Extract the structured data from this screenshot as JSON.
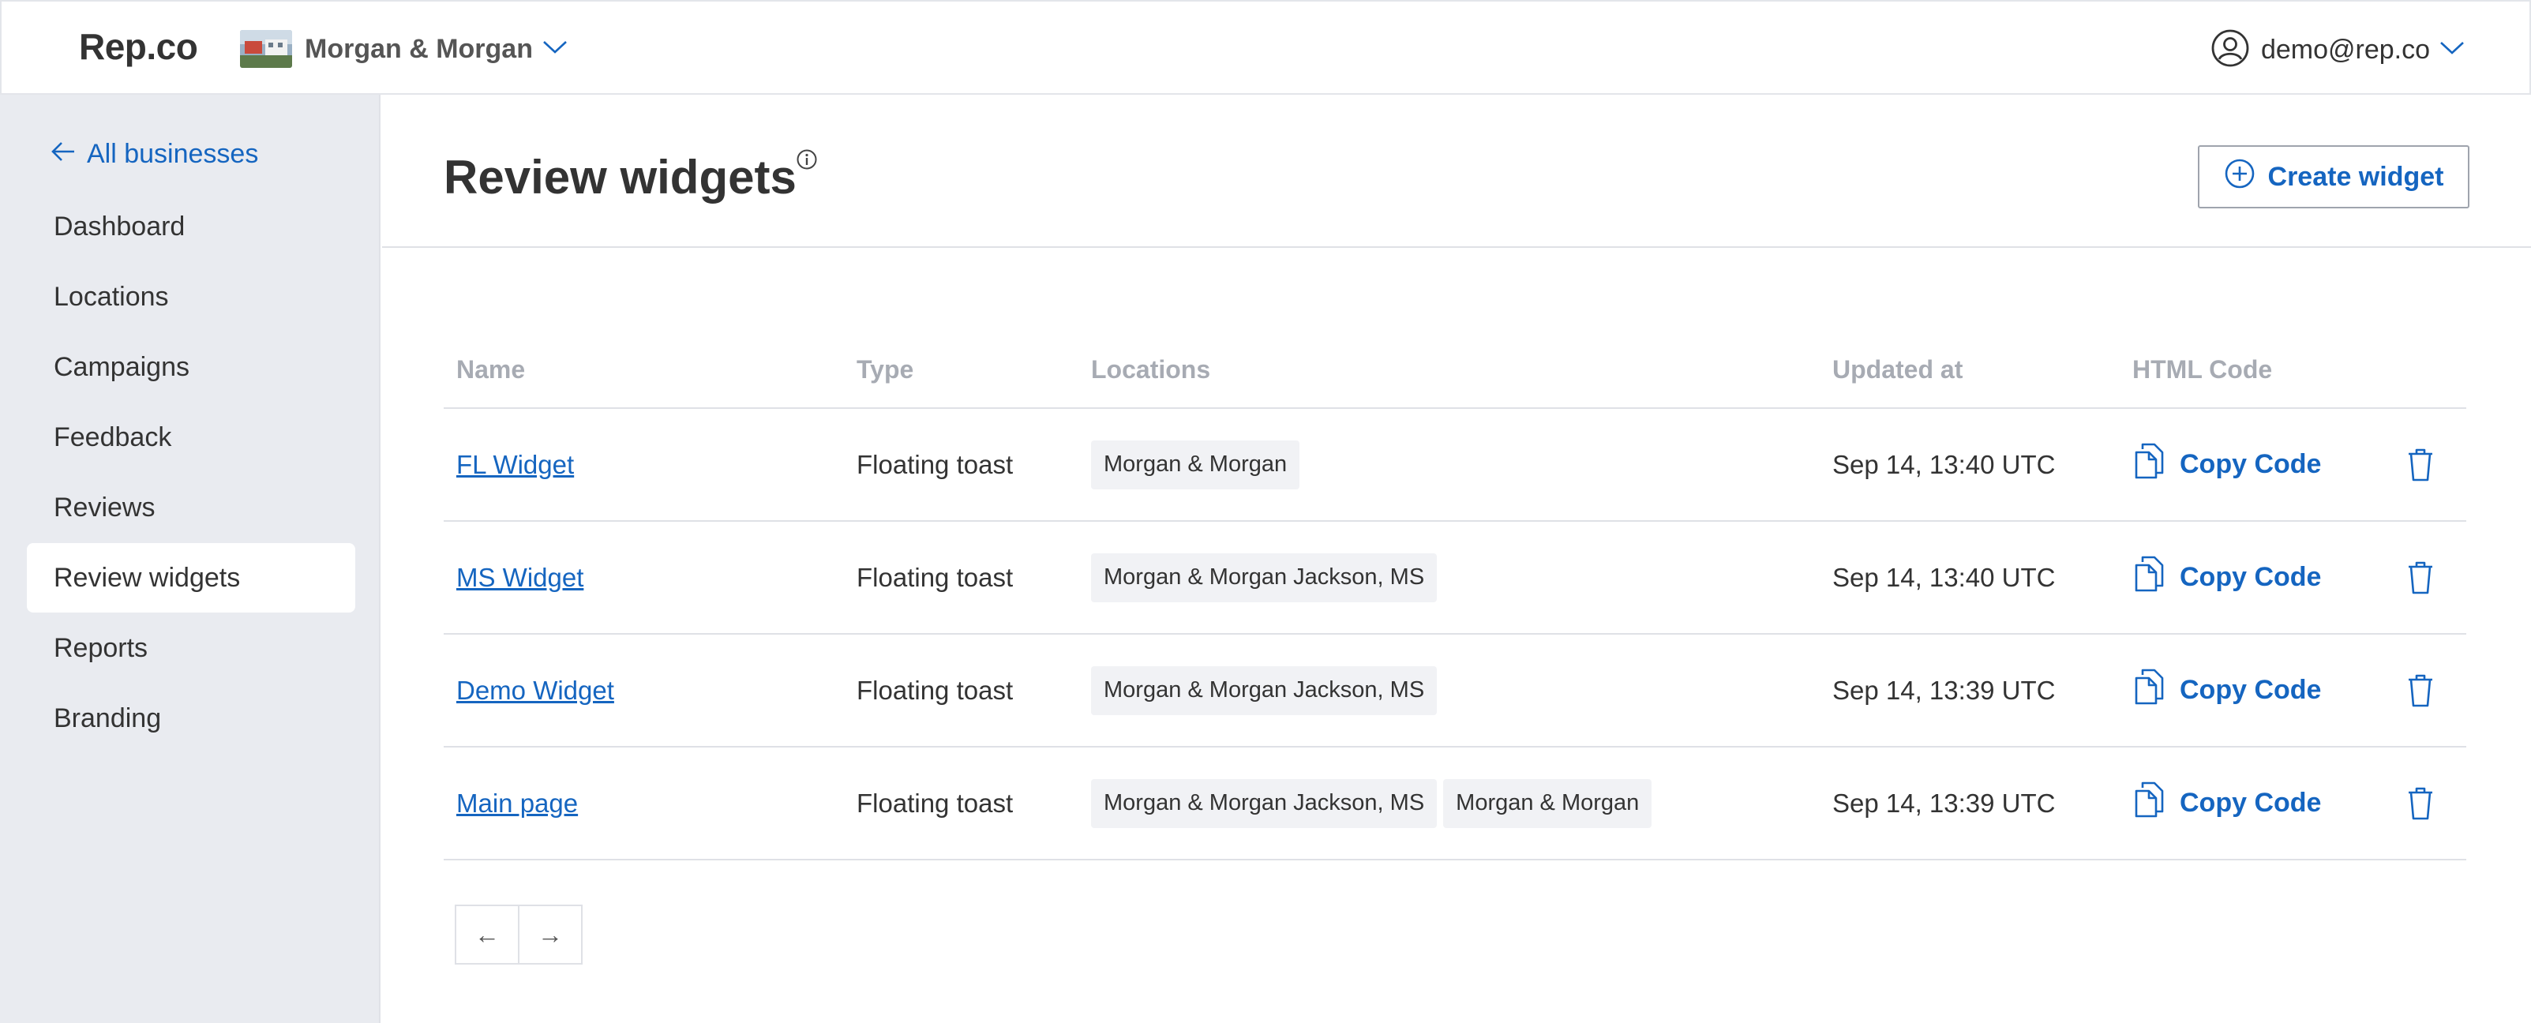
{
  "app": {
    "logo": "Rep.co"
  },
  "business_switcher": {
    "name": "Morgan & Morgan"
  },
  "user_menu": {
    "email": "demo@rep.co"
  },
  "sidebar": {
    "back_label": "All businesses",
    "items": [
      {
        "label": "Dashboard",
        "active": false
      },
      {
        "label": "Locations",
        "active": false
      },
      {
        "label": "Campaigns",
        "active": false
      },
      {
        "label": "Feedback",
        "active": false
      },
      {
        "label": "Reviews",
        "active": false
      },
      {
        "label": "Review widgets",
        "active": true
      },
      {
        "label": "Reports",
        "active": false
      },
      {
        "label": "Branding",
        "active": false
      }
    ]
  },
  "page": {
    "title": "Review widgets",
    "create_button": "Create widget"
  },
  "table": {
    "columns": [
      "Name",
      "Type",
      "Locations",
      "Updated at",
      "HTML Code"
    ],
    "rows": [
      {
        "name": "FL Widget",
        "type": "Floating toast",
        "locations": [
          "Morgan & Morgan"
        ],
        "updated": "Sep 14, 13:40 UTC",
        "action": "Copy Code"
      },
      {
        "name": "MS Widget",
        "type": "Floating toast",
        "locations": [
          "Morgan & Morgan Jackson, MS"
        ],
        "updated": "Sep 14, 13:40 UTC",
        "action": "Copy Code"
      },
      {
        "name": "Demo Widget",
        "type": "Floating toast",
        "locations": [
          "Morgan & Morgan Jackson, MS"
        ],
        "updated": "Sep 14, 13:39 UTC",
        "action": "Copy Code"
      },
      {
        "name": "Main page",
        "type": "Floating toast",
        "locations": [
          "Morgan & Morgan Jackson, MS",
          "Morgan & Morgan"
        ],
        "updated": "Sep 14, 13:39 UTC",
        "action": "Copy Code"
      }
    ]
  },
  "pagination": {
    "prev": "←",
    "next": "→"
  },
  "colors": {
    "accent": "#1565c0",
    "sidebar_bg": "#e9ebf0",
    "header_text": "#a7abb3"
  }
}
